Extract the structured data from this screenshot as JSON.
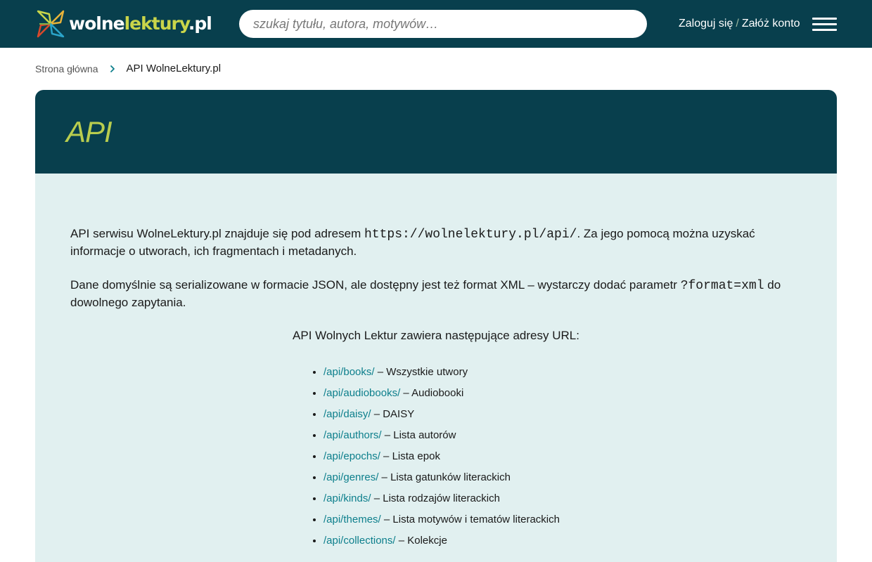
{
  "header": {
    "logo": {
      "part1": "wolne",
      "part2": "lektury",
      "part3": ".pl"
    },
    "search_placeholder": "szukaj tytułu, autora, motywów…",
    "login_label": "Zaloguj się",
    "auth_separator": "/",
    "register_label": "Załóż konto",
    "menu_icon": "hamburger-menu-icon"
  },
  "breadcrumb": {
    "home": "Strona główna",
    "separator_icon": "chevron-right-icon",
    "current": "API WolneLektury.pl"
  },
  "page": {
    "title": "API",
    "intro_before": "API serwisu WolneLektury.pl znajduje się pod adresem ",
    "api_url": "https://wolnelektury.pl/api/",
    "intro_after": ". Za jego pomocą można uzyskać informacje o utworach, ich fragmentach i metadanych.",
    "format_before": "Dane domyślnie są serializowane w formacie JSON, ale dostępny jest też format XML – wystarczy dodać parametr ",
    "format_param": "?format=xml",
    "format_after": " do dowolnego zapytania.",
    "urls_heading": "API Wolnych Lektur zawiera następujące adresy URL:",
    "endpoints": [
      {
        "path": "/api/books/",
        "desc": " – Wszystkie utwory"
      },
      {
        "path": "/api/audiobooks/",
        "desc": " – Audiobooki"
      },
      {
        "path": "/api/daisy/",
        "desc": " – DAISY"
      },
      {
        "path": "/api/authors/",
        "desc": " – Lista autorów"
      },
      {
        "path": "/api/epochs/",
        "desc": " – Lista epok"
      },
      {
        "path": "/api/genres/",
        "desc": " – Lista gatunków literackich"
      },
      {
        "path": "/api/kinds/",
        "desc": " – Lista rodzajów literackich"
      },
      {
        "path": "/api/themes/",
        "desc": " – Lista motywów i tematów literackich"
      },
      {
        "path": "/api/collections/",
        "desc": " – Kolekcje"
      }
    ]
  },
  "colors": {
    "header_bg": "#083f4d",
    "title_accent": "#b9cd4e",
    "content_bg": "#e1f0f0",
    "link": "#0d7f8c"
  }
}
